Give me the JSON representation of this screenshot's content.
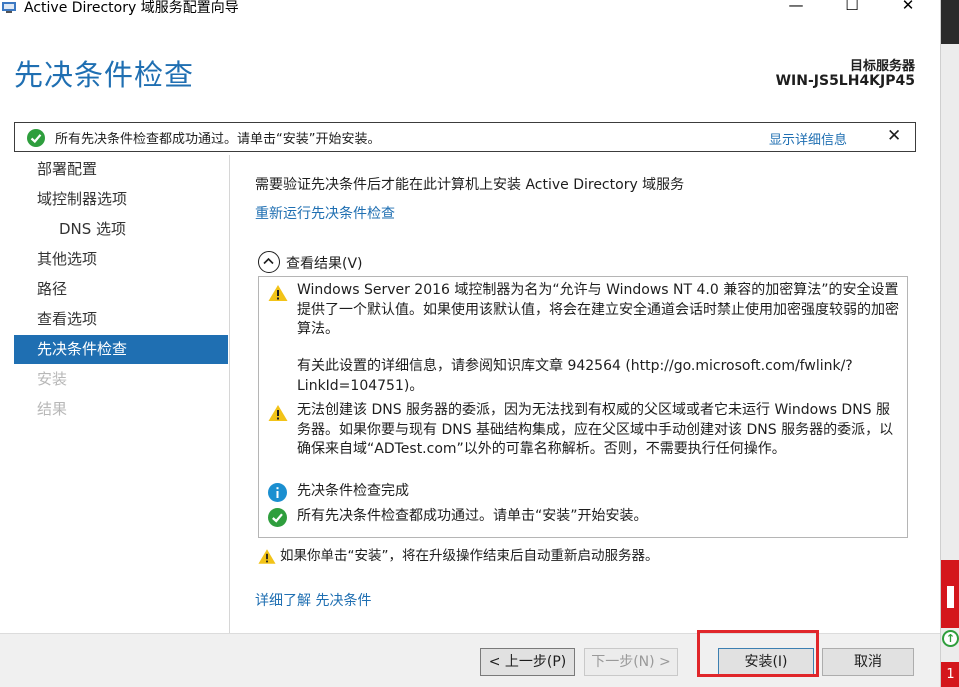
{
  "window": {
    "title": "Active Directory 域服务配置向导",
    "minimize_glyph": "—",
    "maximize_glyph": "☐",
    "close_glyph": "✕"
  },
  "header": {
    "page_title": "先决条件检查",
    "target_label": "目标服务器",
    "target_name": "WIN-JS5LH4KJP45"
  },
  "notification": {
    "text": "所有先决条件检查都成功通过。请单击“安装”开始安装。",
    "details_link": "显示详细信息",
    "close_glyph": "✕"
  },
  "nav": {
    "items": [
      {
        "label": "部署配置",
        "state": "normal"
      },
      {
        "label": "域控制器选项",
        "state": "normal"
      },
      {
        "label": "DNS 选项",
        "state": "sub"
      },
      {
        "label": "其他选项",
        "state": "normal"
      },
      {
        "label": "路径",
        "state": "normal"
      },
      {
        "label": "查看选项",
        "state": "normal"
      },
      {
        "label": "先决条件检查",
        "state": "active"
      },
      {
        "label": "安装",
        "state": "disabled"
      },
      {
        "label": "结果",
        "state": "disabled"
      }
    ]
  },
  "content": {
    "intro": "需要验证先决条件后才能在此计算机上安装 Active Directory 域服务",
    "rerun_link": "重新运行先决条件检查",
    "toggle_label": "查看结果(V)",
    "results": [
      {
        "type": "warning",
        "text": "Windows Server 2016 域控制器为名为“允许与 Windows NT 4.0 兼容的加密算法”的安全设置提供了一个默认值。如果使用该默认值，将会在建立安全通道会话时禁止使用加密强度较弱的加密算法。"
      },
      {
        "type": "warning-cont",
        "text": "有关此设置的详细信息，请参阅知识库文章 942564 (http://go.microsoft.com/fwlink/?LinkId=104751)。"
      },
      {
        "type": "warning",
        "text": "无法创建该 DNS 服务器的委派，因为无法找到有权威的父区域或者它未运行 Windows DNS 服务器。如果你要与现有 DNS 基础结构集成，应在父区域中手动创建对该 DNS 服务器的委派，以确保来自域“ADTest.com”以外的可靠名称解析。否则，不需要执行任何操作。"
      },
      {
        "type": "info",
        "text": "先决条件检查完成"
      },
      {
        "type": "success",
        "text": "所有先决条件检查都成功通过。请单击“安装”开始安装。"
      }
    ],
    "restart_note": "如果你单击“安装”，将在升级操作结束后自动重新启动服务器。",
    "learn_more_link": "详细了解 先决条件"
  },
  "footer": {
    "prev": "< 上一步(P)",
    "next": "下一步(N) >",
    "install": "安装(I)",
    "cancel": "取消"
  },
  "side_strip": {
    "badge_number": "1",
    "arrow_glyph": "↑"
  },
  "colors": {
    "accent": "#1f6fb2",
    "warning": "#f2c318",
    "success": "#2e9e3d",
    "info": "#1b8fd0",
    "highlight": "#e0262a"
  }
}
